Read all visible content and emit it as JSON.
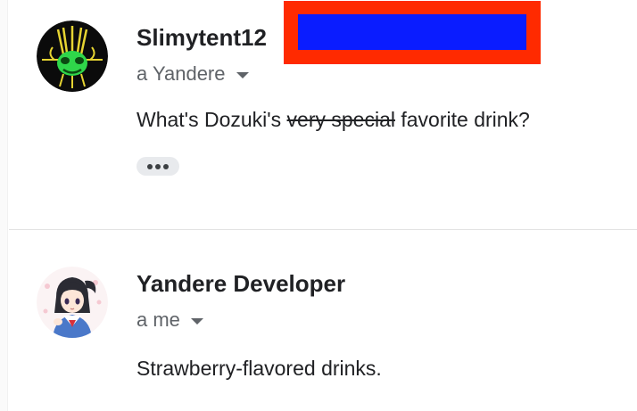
{
  "colors": {
    "redaction_outer": "#ff2a00",
    "redaction_inner": "#0a1cff",
    "text_primary": "#202124",
    "text_secondary": "#5f6368"
  },
  "messages": [
    {
      "sender": "Slimytent12",
      "recipient_label": "a Yandere",
      "body_prefix": "What's Dozuki's ",
      "body_strikethrough": "very special",
      "body_suffix": " favorite drink?",
      "avatar_icon": "green-creature-avatar-icon",
      "has_collapsed_content": true
    },
    {
      "sender": "Yandere Developer",
      "recipient_label": "a me",
      "body": "Strawberry-flavored drinks.",
      "avatar_icon": "anime-schoolgirl-avatar-icon"
    }
  ]
}
